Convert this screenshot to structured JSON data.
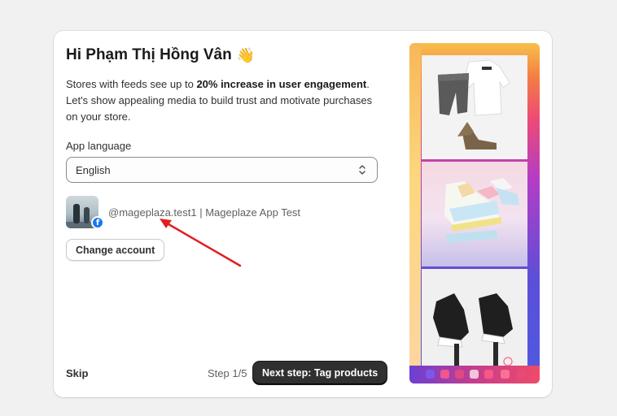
{
  "card": {
    "title": "Hi Phạm Thị Hồng Vân",
    "wave_emoji": "👋",
    "description_prefix": "Stores with feeds see up to ",
    "description_bold": "20% increase in user engagement",
    "description_suffix": ".",
    "description_line2": "Let's show appealing media to build trust and motivate purchases on your store."
  },
  "language": {
    "label": "App language",
    "selected": "English"
  },
  "account": {
    "handle": "@mageplaza.test1 | Mageplaze App Test",
    "badge_glyph": "f",
    "change_label": "Change account"
  },
  "footer": {
    "skip_label": "Skip",
    "step_text": "Step 1/5",
    "next_label": "Next step: Tag products"
  },
  "colors": {
    "primary_button": "#303030",
    "facebook": "#1877f2",
    "annotation_arrow": "#e02020"
  }
}
